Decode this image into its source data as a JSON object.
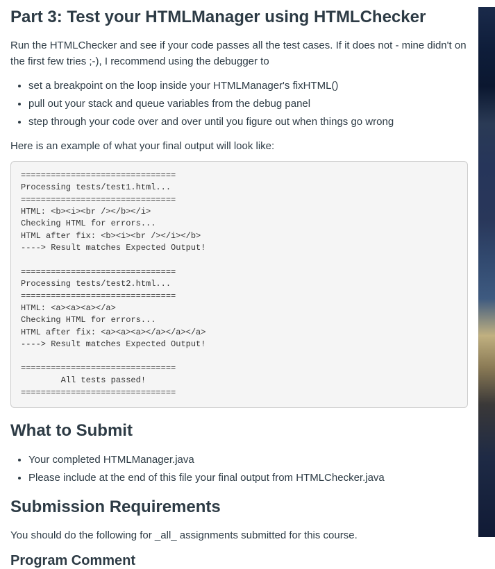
{
  "part3": {
    "heading": "Part 3: Test your HTMLManager using HTMLChecker",
    "intro": "Run the HTMLChecker and see if your code passes all the test cases. If it does not - mine didn't on the first few tries ;-), I recommend using the debugger to",
    "steps": [
      "set a breakpoint on the loop inside your HTMLManager's fixHTML()",
      "pull out your stack and queue variables from the debug panel",
      "step through your code over and over until you figure out when things go wrong"
    ],
    "example_label": "Here is an example of what your final output will look like:",
    "code": "===============================\nProcessing tests/test1.html...\n===============================\nHTML: <b><i><br /></b></i>\nChecking HTML for errors...\nHTML after fix: <b><i><br /></i></b>\n----> Result matches Expected Output!\n\n===============================\nProcessing tests/test2.html...\n===============================\nHTML: <a><a><a></a>\nChecking HTML for errors...\nHTML after fix: <a><a><a></a></a></a>\n----> Result matches Expected Output!\n\n===============================\n        All tests passed!\n==============================="
  },
  "submit": {
    "heading": "What to Submit",
    "items": [
      "Your completed HTMLManager.java",
      "Please include at the end of this file your final output from HTMLChecker.java"
    ]
  },
  "requirements": {
    "heading": "Submission Requirements",
    "intro": "You should do the following for _all_ assignments submitted for this course."
  },
  "comment": {
    "heading": "Program Comment"
  }
}
